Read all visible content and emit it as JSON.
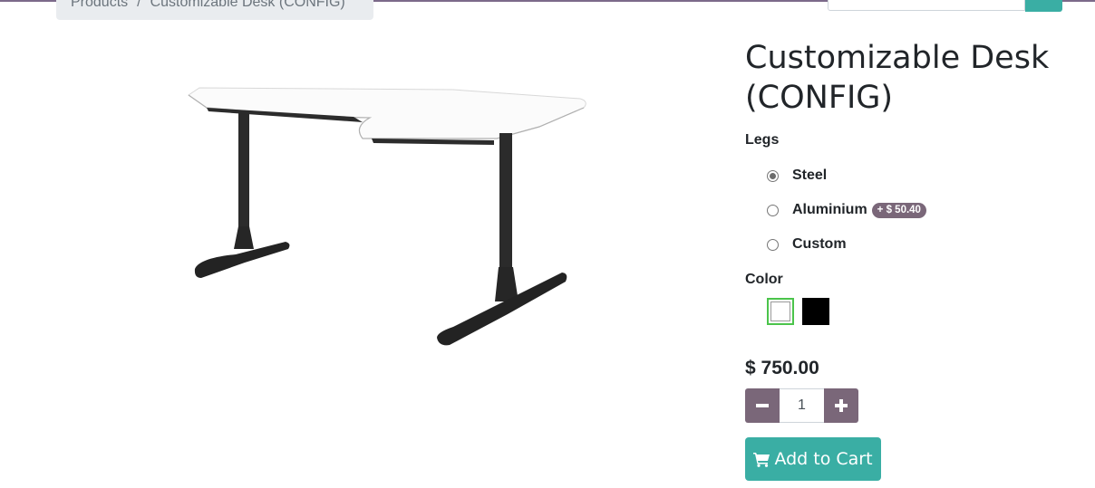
{
  "breadcrumb": {
    "items": [
      "Products",
      "Customizable Desk (CONFIG)"
    ],
    "separator": "/"
  },
  "search": {
    "placeholder": ""
  },
  "product": {
    "name": "Customizable Desk (CONFIG)",
    "image_alt": "desk-image",
    "attributes": [
      {
        "label": "Legs",
        "options": [
          {
            "label": "Steel",
            "selected": true,
            "extra": ""
          },
          {
            "label": "Aluminium",
            "selected": false,
            "extra": "+ $ 50.40"
          },
          {
            "label": "Custom",
            "selected": false,
            "extra": ""
          }
        ]
      },
      {
        "label": "Color",
        "swatches": [
          {
            "color": "#ffffff",
            "selected": true
          },
          {
            "color": "#000000",
            "selected": false
          }
        ]
      }
    ],
    "price": "$ 750.00",
    "quantity": "1",
    "add_to_cart": "Add to Cart"
  },
  "colors": {
    "accent": "#3aaea4",
    "secondary": "#7a6779",
    "selected_swatch_border": "#4bc44b"
  }
}
